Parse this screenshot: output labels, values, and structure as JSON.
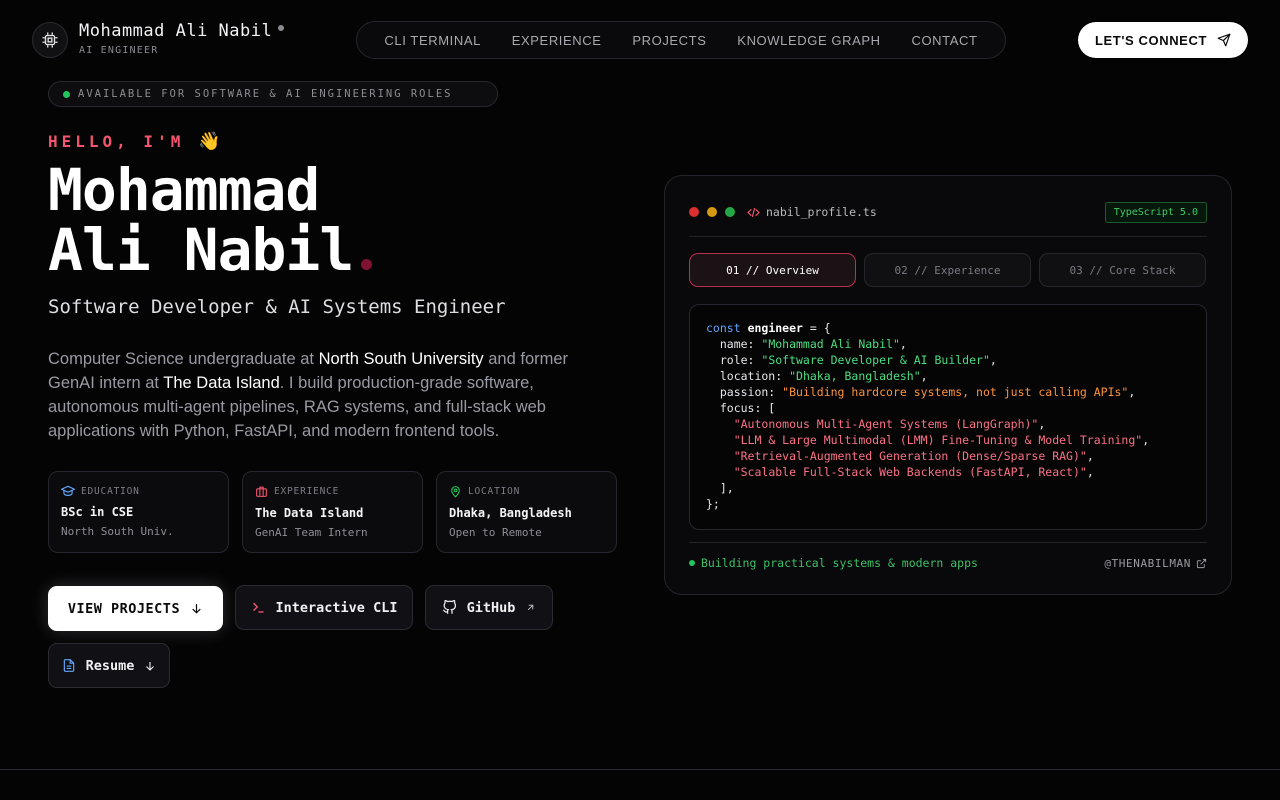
{
  "header": {
    "brand_name": "Mohammad Ali Nabil",
    "brand_role": "AI ENGINEER",
    "nav": [
      "CLI TERMINAL",
      "EXPERIENCE",
      "PROJECTS",
      "KNOWLEDGE GRAPH",
      "CONTACT"
    ],
    "cta": "LET'S CONNECT"
  },
  "hero": {
    "availability": "AVAILABLE FOR SOFTWARE & AI ENGINEERING ROLES",
    "greeting": "HELLO, I'M",
    "greeting_emoji": "👋",
    "name_line1": "Mohammad",
    "name_line2": "Ali Nabil",
    "subtitle": "Software Developer & AI Systems Engineer",
    "bio": {
      "p1": "Computer Science undergraduate at ",
      "u1": "North South University",
      "p2": " and former GenAI intern at ",
      "u2": "The Data Island",
      "p3": ". I build production-grade software, autonomous multi-agent pipelines, RAG systems, and full-stack web applications with Python, FastAPI, and modern frontend tools."
    },
    "cards": [
      {
        "label": "EDUCATION",
        "title": "BSc in CSE",
        "sub": "North South Univ.",
        "icon": "graduation-cap-icon"
      },
      {
        "label": "EXPERIENCE",
        "title": "The Data Island",
        "sub": "GenAI Team Intern",
        "icon": "briefcase-icon"
      },
      {
        "label": "LOCATION",
        "title": "Dhaka, Bangladesh",
        "sub": "Open to Remote",
        "icon": "map-pin-icon"
      }
    ],
    "buttons": {
      "projects": "VIEW PROJECTS",
      "cli": "Interactive CLI",
      "github": "GitHub",
      "resume": "Resume"
    }
  },
  "panel": {
    "filename": "nabil_profile.ts",
    "badge": "TypeScript 5.0",
    "tabs": [
      "01 // Overview",
      "02 // Experience",
      "03 // Core Stack"
    ],
    "active_tab": 0,
    "code": {
      "kw": "const",
      "var": "engineer",
      "name_val": "\"Mohammad Ali Nabil\"",
      "role_val": "\"Software Developer & AI Builder\"",
      "location_val": "\"Dhaka, Bangladesh\"",
      "passion_val": "\"Building hardcore systems, not just calling APIs\"",
      "focus": [
        "\"Autonomous Multi-Agent Systems (LangGraph)\"",
        "\"LLM & Large Multimodal (LMM) Fine-Tuning & Model Training\"",
        "\"Retrieval-Augmented Generation (Dense/Sparse RAG)\"",
        "\"Scalable Full-Stack Web Backends (FastAPI, React)\""
      ]
    },
    "footer_status": "Building practical systems & modern apps",
    "footer_handle": "@THENABILMAN"
  },
  "colors": {
    "accent": "#f2556d",
    "green": "#22c55e",
    "background": "#040405"
  }
}
